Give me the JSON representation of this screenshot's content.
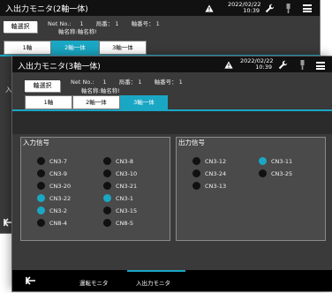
{
  "back_screen": {
    "title": "入出力モニタ(2軸一体)",
    "date": "2022/02/22",
    "time": "10:39",
    "axis_select_button": "軸選択",
    "net_no_label": "Net No.:",
    "net_no_value": "1",
    "axis_no_label": "局番：",
    "axis_no_value": "1",
    "axis_num_label": "軸番号：",
    "axis_num_value": "1",
    "axis_name_label": "軸名称:",
    "axis_name_value": "軸名称!",
    "tabs": [
      "1軸",
      "2軸一体",
      "3軸一体"
    ],
    "active_tab": 1,
    "left_partial_label": "入力"
  },
  "front_screen": {
    "title": "入出力モニタ(3軸一体)",
    "date": "2022/02/22",
    "time": "10:39",
    "axis_select_button": "軸選択",
    "net_no_label": "Net No.:",
    "net_no_value": "1",
    "axis_no_label": "局番：",
    "axis_no_value": "1",
    "axis_num_label": "軸番号：",
    "axis_num_value": "1",
    "axis_name_label": "軸名称:",
    "axis_name_value": "軸名称!",
    "tabs": [
      "1軸",
      "2軸一体",
      "3軸一体"
    ],
    "active_tab": 2,
    "input_panel": {
      "title": "入力信号",
      "signals": [
        {
          "name": "CN3-7",
          "on": false
        },
        {
          "name": "CN3-8",
          "on": false
        },
        {
          "name": "CN3-9",
          "on": false
        },
        {
          "name": "CN3-10",
          "on": false
        },
        {
          "name": "CN3-20",
          "on": false
        },
        {
          "name": "CN3-21",
          "on": false
        },
        {
          "name": "CN3-22",
          "on": true
        },
        {
          "name": "CN3-1",
          "on": true
        },
        {
          "name": "CN3-2",
          "on": true
        },
        {
          "name": "CN3-15",
          "on": false
        },
        {
          "name": "CN8-4",
          "on": false
        },
        {
          "name": "CN8-5",
          "on": false
        }
      ]
    },
    "output_panel": {
      "title": "出力信号",
      "signals": [
        {
          "name": "CN3-12",
          "on": false
        },
        {
          "name": "CN3-11",
          "on": true
        },
        {
          "name": "CN3-24",
          "on": false
        },
        {
          "name": "CN3-25",
          "on": false
        },
        {
          "name": "CN3-13",
          "on": false
        }
      ]
    },
    "bottom_nav": {
      "items": [
        "運転モニタ",
        "入出力モニタ"
      ],
      "active": 1
    }
  },
  "colors": {
    "accent": "#1aa7c4",
    "signal_off": "#111111",
    "panel_bg": "#3a3a3a"
  },
  "icons": {
    "warning": "warning-triangle-icon",
    "settings": "wrench-icon",
    "connection": "plug-icon",
    "menu": "hamburger-menu-icon",
    "back": "back-arrow-icon"
  }
}
